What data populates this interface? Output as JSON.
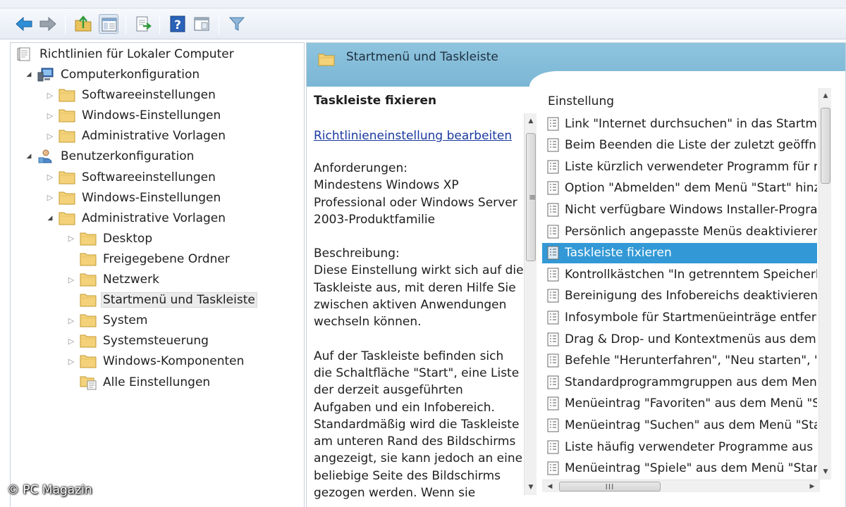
{
  "tree": {
    "root": "Richtlinien für Lokaler Computer",
    "items": [
      {
        "label": "Computerkonfiguration"
      },
      {
        "label": "Softwareeinstellungen"
      },
      {
        "label": "Windows-Einstellungen"
      },
      {
        "label": "Administrative Vorlagen"
      },
      {
        "label": "Benutzerkonfiguration"
      },
      {
        "label": "Softwareeinstellungen"
      },
      {
        "label": "Windows-Einstellungen"
      },
      {
        "label": "Administrative Vorlagen"
      },
      {
        "label": "Desktop"
      },
      {
        "label": "Freigegebene Ordner"
      },
      {
        "label": "Netzwerk"
      },
      {
        "label": "Startmenü und Taskleiste"
      },
      {
        "label": "System"
      },
      {
        "label": "Systemsteuerung"
      },
      {
        "label": "Windows-Komponenten"
      },
      {
        "label": "Alle Einstellungen"
      }
    ]
  },
  "right": {
    "header_title": "Startmenü und Taskleiste",
    "desc_title": "Taskleiste fixieren",
    "edit_link": "Richtlinieneinstellung bearbeiten",
    "requirements": "Anforderungen:\nMindestens Windows XP Professional oder Windows Server 2003-Produktfamilie",
    "description": "Beschreibung:\nDiese Einstellung wirkt sich auf die Taskleiste aus, mit deren Hilfe Sie zwischen aktiven Anwendungen wechseln können.",
    "paragraph": "Auf der Taskleiste befinden sich die Schaltfläche \"Start\", eine Liste der derzeit ausgeführten Aufgaben und ein Infobereich. Standardmäßig wird die Taskleiste am unteren Rand des Bildschirms angezeigt, sie kann jedoch an eine beliebige Seite des Bildschirms gezogen werden. Wenn sie",
    "column_header": "Einstellung",
    "settings": [
      {
        "label": "Link \"Internet durchsuchen\" in das Startmenü"
      },
      {
        "label": "Beim Beenden die Liste der zuletzt geöffnete"
      },
      {
        "label": "Liste kürzlich verwendeter Programm für ne"
      },
      {
        "label": "Option \"Abmelden\" dem Menü \"Start\" hinzu"
      },
      {
        "label": "Nicht verfügbare Windows Installer-Program"
      },
      {
        "label": "Persönlich angepasste Menüs deaktivieren"
      },
      {
        "label": "Taskleiste fixieren"
      },
      {
        "label": "Kontrollkästchen \"In getrenntem Speicherbe"
      },
      {
        "label": "Bereinigung des Infobereichs deaktivieren"
      },
      {
        "label": "Infosymbole für Startmenüeinträge entferne"
      },
      {
        "label": "Drag & Drop- und Kontextmenüs aus dem S"
      },
      {
        "label": "Befehle \"Herunterfahren\", \"Neu starten\", \"E"
      },
      {
        "label": "Standardprogrammgruppen aus dem Menü"
      },
      {
        "label": "Menüeintrag \"Favoriten\" aus dem Menü \"St"
      },
      {
        "label": "Menüeintrag \"Suchen\" aus dem Menü \"Star"
      },
      {
        "label": "Liste häufig verwendeter Programme aus de"
      },
      {
        "label": "Menüeintrag \"Spiele\" aus dem Menü \"Start\""
      }
    ],
    "selected_index": 6
  },
  "hscroll_grip": "III",
  "vscroll_grip": "≡",
  "watermark": "© PC Magazin"
}
